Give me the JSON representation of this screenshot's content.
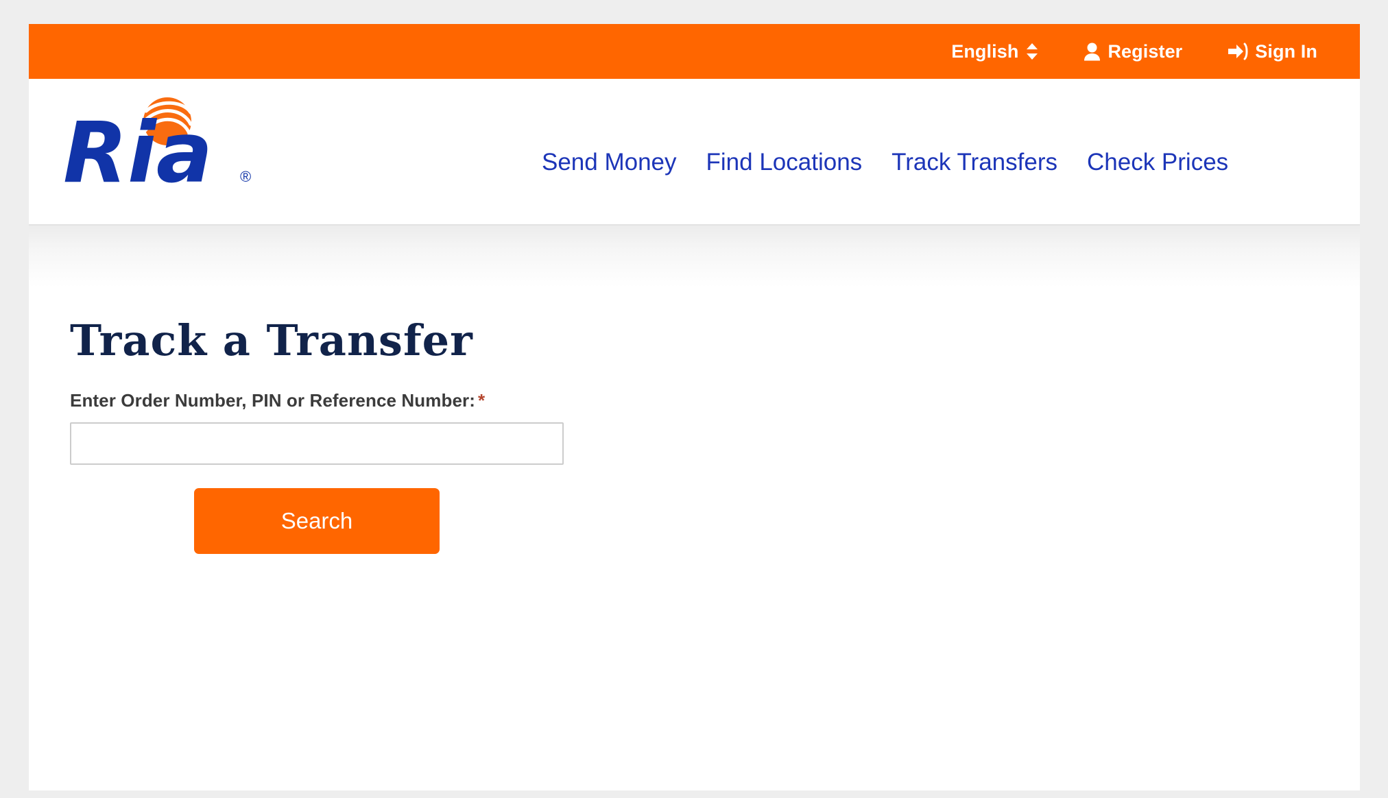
{
  "topbar": {
    "language": {
      "label": "English",
      "icon": "sort-updown-icon"
    },
    "register": {
      "label": "Register",
      "icon": "user-icon"
    },
    "signin": {
      "label": "Sign In",
      "icon": "sign-in-icon"
    }
  },
  "header": {
    "logo_text": "Ria",
    "logo_mark": "orange-sphere-icon",
    "nav": [
      {
        "label": "Send Money"
      },
      {
        "label": "Find Locations"
      },
      {
        "label": "Track Transfers"
      },
      {
        "label": "Check Prices"
      }
    ]
  },
  "main": {
    "title": "Track a Transfer",
    "field_label": "Enter Order Number, PIN or Reference Number:",
    "required_marker": "*",
    "input_value": "",
    "input_placeholder": "",
    "search_label": "Search"
  },
  "colors": {
    "brand_orange": "#ff6600",
    "brand_blue": "#1c35b8",
    "title_navy": "#11234a",
    "required_red": "#b5472f",
    "page_background": "#eeeeee",
    "input_border": "#cccccc"
  }
}
